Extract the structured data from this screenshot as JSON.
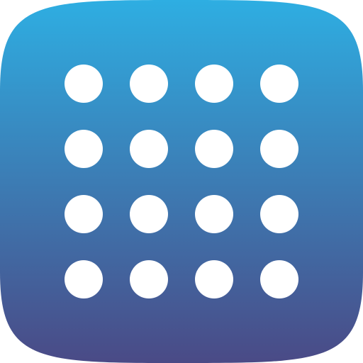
{
  "app_icon": {
    "icon_name": "dot-grid-icon",
    "grid": {
      "rows": 4,
      "columns": 4
    },
    "colors": {
      "gradient_top": "#2eaee2",
      "gradient_bottom": "#4a4a86",
      "dot": "#ffffff"
    }
  }
}
